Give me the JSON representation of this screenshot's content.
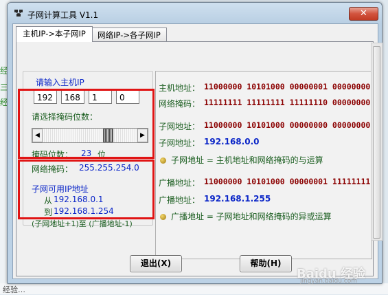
{
  "background": {
    "left_fragments": [
      "经",
      "三",
      "经"
    ],
    "bottom_fragment": "经验…"
  },
  "window": {
    "title": "子网计算工具  V1.1",
    "close_symbol": "✕"
  },
  "tabs": [
    {
      "label": "主机IP->本子网IP",
      "active": true
    },
    {
      "label": "网络IP->各子网IP",
      "active": false
    }
  ],
  "left": {
    "host_ip_label": "请输入主机IP",
    "ip_octets": [
      "192",
      "168",
      "1",
      "0"
    ],
    "mask_select_label": "请选择掩码位数：",
    "mask_bits_label": "掩码位数：",
    "mask_bits_value": "23",
    "mask_bits_unit": "位",
    "netmask_label": "网络掩码：",
    "netmask_value": "255.255.254.0",
    "slider_value_bits": 23,
    "usable_label": "子网可用IP地址",
    "from_label": "从",
    "from_value": "192.168.0.1",
    "to_label": "到",
    "to_value": "192.168.1.254",
    "formula": "(子网地址+1)至 (广播地址-1)"
  },
  "right": {
    "host_addr_label": "主机地址：",
    "host_addr_bits": "11000000  10101000  00000001  00000000",
    "netmask_label": "网络掩码：",
    "netmask_bits": "11111111  11111111  11111110  00000000",
    "subnet_addr_label": "子网地址：",
    "subnet_addr_bits": "11000000  10101000  00000000  00000000",
    "subnet_addr_label2": "子网地址：",
    "subnet_addr_value": "192.168.0.0",
    "subnet_note": "子网地址 = 主机地址和网络掩码的与运算",
    "broadcast_label": "广播地址：",
    "broadcast_bits": "11000000  10101000  00000001  11111111",
    "broadcast_label2": "广播地址：",
    "broadcast_value": "192.168.1.255",
    "broadcast_note": "广播地址 = 子网地址和网络掩码的异或运算"
  },
  "buttons": {
    "exit": "退出(X)",
    "help": "帮助(H)"
  },
  "watermark": {
    "text": "Baidu 经验",
    "sub": "jingyan.baidu.com"
  },
  "colors": {
    "highlight_box": "#e01414",
    "binary_text": "#8b0000",
    "value_text": "#0b26c8",
    "label_text": "#1b5e20"
  }
}
